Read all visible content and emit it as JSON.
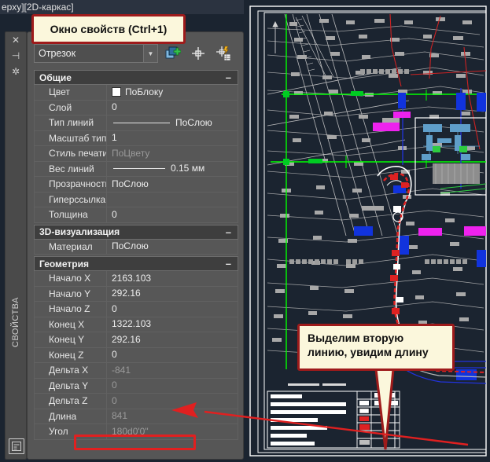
{
  "titlebar": {
    "text": "ерху][2D-каркас]"
  },
  "dock": {
    "label": "СВОЙСТВА",
    "icons": [
      {
        "name": "close-icon",
        "glyph": "✕"
      },
      {
        "name": "auto-hide-icon",
        "glyph": "⊣"
      },
      {
        "name": "palette-settings-icon",
        "glyph": "✲"
      }
    ],
    "bottom_icon": "properties-palette-icon"
  },
  "palette": {
    "object_type": "Отрезок",
    "combo_arrow": "▼",
    "toolbar_icons": [
      {
        "name": "quick-select-add-icon"
      },
      {
        "name": "pick-point-icon"
      },
      {
        "name": "quick-select-icon"
      }
    ],
    "collapse_glyph": "–",
    "sections": [
      {
        "title": "Общие",
        "rows": [
          {
            "name": "Цвет",
            "value": "ПоБлоку",
            "kind": "color",
            "dim": false
          },
          {
            "name": "Слой",
            "value": "0",
            "kind": "text",
            "dim": false
          },
          {
            "name": "Тип линий",
            "value": "ПоСлою",
            "kind": "linetype",
            "dim": false
          },
          {
            "name": "Масштаб тип...",
            "value": "1",
            "kind": "text",
            "dim": false
          },
          {
            "name": "Стиль печати",
            "value": "ПоЦвету",
            "kind": "text",
            "dim": true
          },
          {
            "name": "Вес линий",
            "value": "0.15 мм",
            "kind": "lineweight",
            "dim": false
          },
          {
            "name": "Прозрачность",
            "value": "ПоСлою",
            "kind": "text",
            "dim": false
          },
          {
            "name": "Гиперссылка",
            "value": "",
            "kind": "text",
            "dim": false
          },
          {
            "name": "Толщина",
            "value": "0",
            "kind": "text",
            "dim": false
          }
        ]
      },
      {
        "title": "3D-визуализация",
        "rows": [
          {
            "name": "Материал",
            "value": "ПоСлою",
            "kind": "text",
            "dim": false
          }
        ]
      },
      {
        "title": "Геометрия",
        "rows": [
          {
            "name": "Начало X",
            "value": "2163.103",
            "kind": "text",
            "dim": false
          },
          {
            "name": "Начало Y",
            "value": "292.16",
            "kind": "text",
            "dim": false
          },
          {
            "name": "Начало Z",
            "value": "0",
            "kind": "text",
            "dim": false
          },
          {
            "name": "Конец X",
            "value": "1322.103",
            "kind": "text",
            "dim": false
          },
          {
            "name": "Конец Y",
            "value": "292.16",
            "kind": "text",
            "dim": false
          },
          {
            "name": "Конец Z",
            "value": "0",
            "kind": "text",
            "dim": false
          },
          {
            "name": "Дельта X",
            "value": "-841",
            "kind": "text",
            "dim": true
          },
          {
            "name": "Дельта Y",
            "value": "0",
            "kind": "text",
            "dim": true
          },
          {
            "name": "Дельта Z",
            "value": "0",
            "kind": "text",
            "dim": true
          },
          {
            "name": "Длина",
            "value": "841",
            "kind": "text",
            "dim": true
          },
          {
            "name": "Угол",
            "value": "180d0'0\"",
            "kind": "text",
            "dim": true
          }
        ]
      }
    ]
  },
  "annotations": {
    "callout_top": "Окно свойств (Ctrl+1)",
    "callout_right_line1": "Выделим вторую",
    "callout_right_line2": "линию, увидим длину",
    "highlight_target": "Длина"
  },
  "colors": {
    "callout_bg": "#fbf7dc",
    "callout_border": "#9e1b1b",
    "highlight": "#e02020",
    "canvas_bg": "#1b2430",
    "selection_green": "#00ff00",
    "palette_bg": "#565656"
  }
}
